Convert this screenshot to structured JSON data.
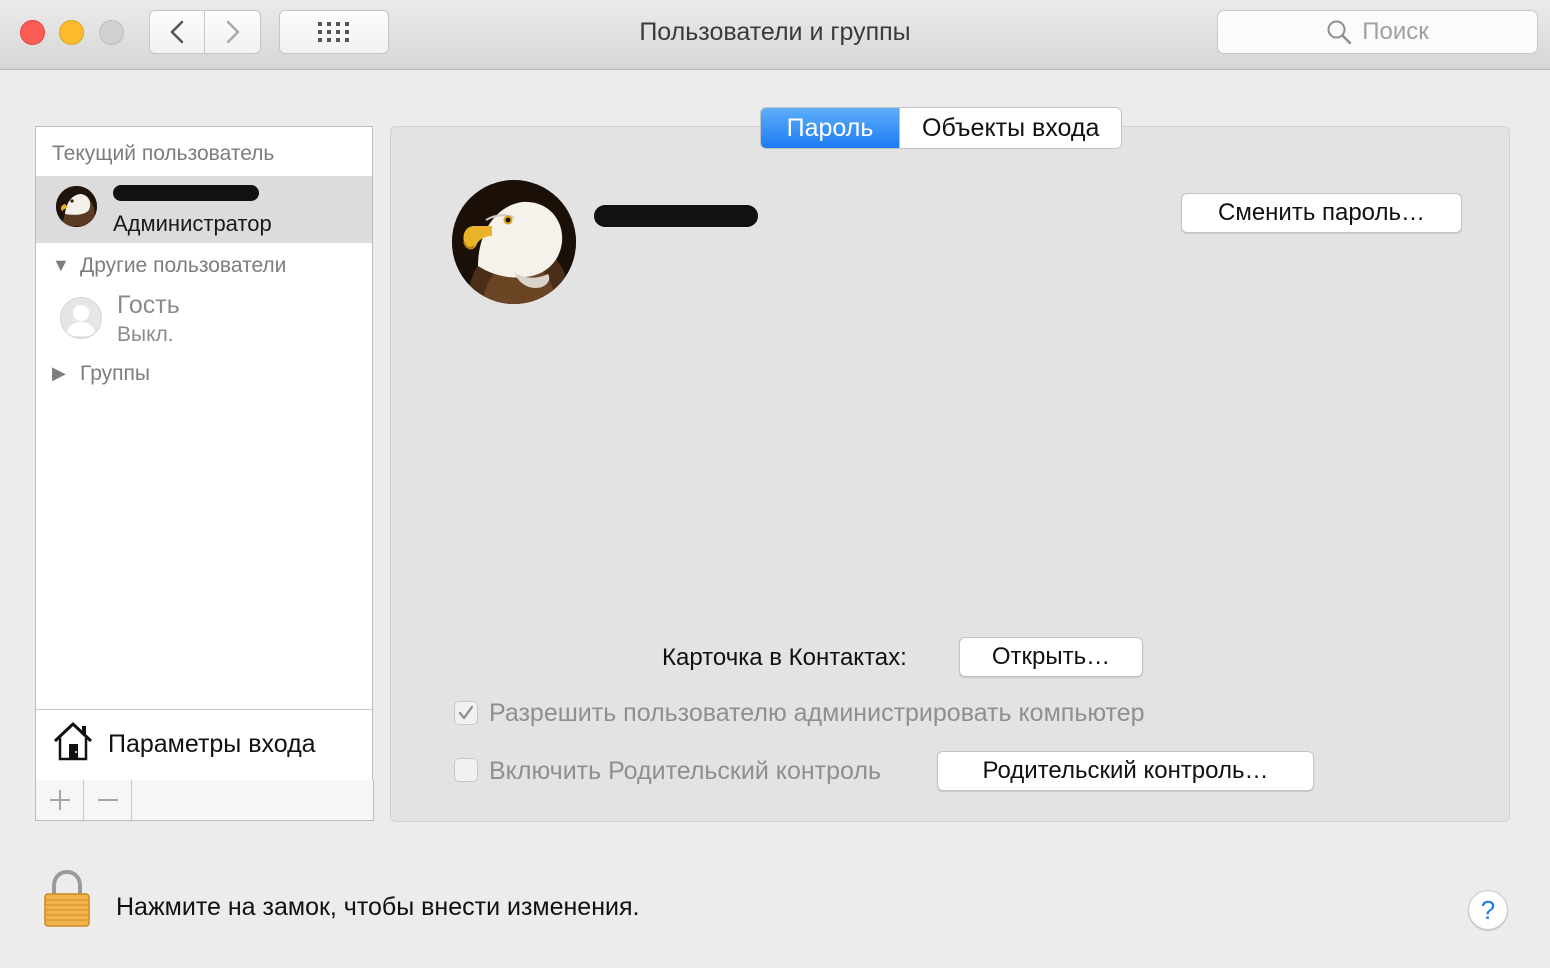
{
  "window": {
    "title": "Пользователи и группы",
    "search_placeholder": "Поиск"
  },
  "sidebar": {
    "current_user_header": "Текущий пользователь",
    "current_user": {
      "role": "Администратор"
    },
    "other_users_header": "Другие пользователи",
    "guest": {
      "name": "Гость",
      "status": "Выкл."
    },
    "groups_header": "Группы",
    "login_options": "Параметры входа"
  },
  "tabs": [
    {
      "label": "Пароль",
      "active": true
    },
    {
      "label": "Объекты входа",
      "active": false
    }
  ],
  "main": {
    "change_password": "Сменить пароль…",
    "contacts_card_label": "Карточка в Контактах:",
    "open_button": "Открыть…",
    "allow_admin": {
      "label": "Разрешить пользователю администрировать компьютер",
      "checked": true
    },
    "parental_controls": {
      "label": "Включить Родительский контроль",
      "checked": false
    },
    "parental_controls_button": "Родительский контроль…"
  },
  "footer": {
    "lock_text": "Нажмите на замок, чтобы внести изменения.",
    "help": "?"
  },
  "colors": {
    "accent": "#1b7bf4",
    "close": "#fc5d57",
    "minimize": "#fdbb2e",
    "zoom_disabled": "#d0d0d0"
  },
  "icons": [
    "back-icon",
    "forward-icon",
    "grid-icon",
    "search-icon",
    "house-icon",
    "lock-icon",
    "plus-icon",
    "minus-icon",
    "disclosure-open-icon",
    "disclosure-closed-icon",
    "checkmark-icon"
  ]
}
